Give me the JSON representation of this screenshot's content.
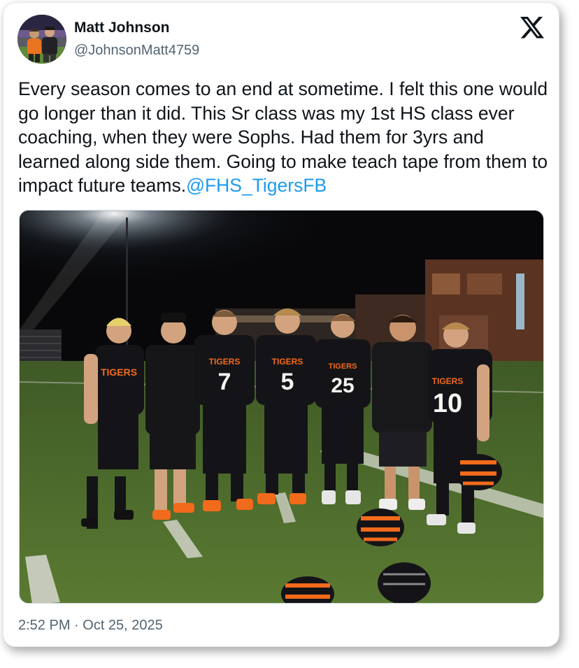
{
  "author": {
    "display_name": "Matt Johnson",
    "handle": "@JohnsonMatt4759",
    "avatar_icon": "profile-photo"
  },
  "platform": {
    "logo_icon": "x-logo-icon"
  },
  "tweet": {
    "text": "Every season comes to an end at sometime. I felt this one would go longer than it did. This Sr class was my 1st HS class ever coaching, when they were Sophs. Had them for 3yrs and learned along side them. Going to make teach tape from them to impact future teams.",
    "mention": "@FHS_TigersFB",
    "timestamp": "2:52 PM · Oct 25, 2025"
  },
  "photo": {
    "jersey_numbers": [
      "7",
      "5",
      "25",
      "10"
    ],
    "jersey_word": "TIGERS",
    "colors": {
      "jersey": "#141418",
      "accent": "#f26a1b",
      "turf": "#4c6a2a",
      "sky": "#08080a"
    }
  },
  "colors": {
    "mention_blue": "#1d9bf0",
    "text": "#0f1419",
    "secondary_text": "#536471"
  }
}
